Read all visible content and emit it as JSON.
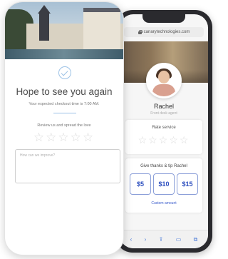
{
  "front_screen": {
    "title": "Hope to see you again",
    "checkout_message": "Your expected checkout time is 7:00 AM.",
    "review_prompt": "Review us and spread the love",
    "stars": "☆☆☆☆☆",
    "feedback_placeholder": "How can we improve?"
  },
  "back_screen": {
    "url": "canarytechnologies.com",
    "agent": {
      "name": "Rachel",
      "role": "Front desk agent"
    },
    "rate_service": {
      "title": "Rate service",
      "stars": "☆☆☆☆☆"
    },
    "tip": {
      "title": "Give thanks & tip Rachel",
      "options": [
        "$5",
        "$10",
        "$15"
      ],
      "custom_label": "Custom amount"
    },
    "browser_nav": {
      "back": "‹",
      "forward": "›",
      "share": "⇪",
      "bookmarks": "▭",
      "tabs": "⧉"
    }
  },
  "colors": {
    "accent_blue": "#2d4fbf",
    "check_blue": "#9cc2e6",
    "star_gray": "#dcdcdc",
    "phone_dark": "#2a2a2e"
  }
}
